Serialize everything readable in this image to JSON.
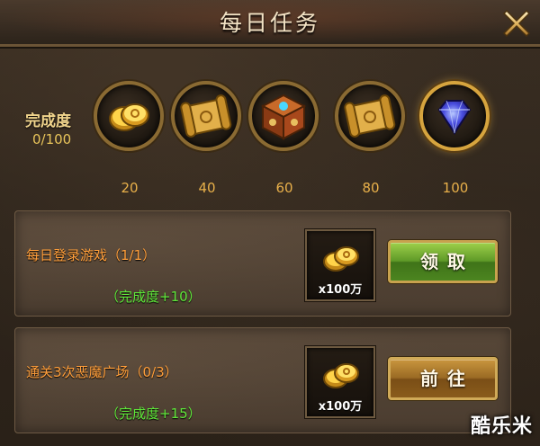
{
  "window": {
    "title": "每日任务",
    "close_icon": "close-x-icon"
  },
  "progress": {
    "label": "完成度",
    "value": "0/100",
    "current": 0,
    "max": 100
  },
  "rewards": [
    {
      "threshold": "20",
      "icon": "gold-coins-icon"
    },
    {
      "threshold": "40",
      "icon": "golden-scroll-icon"
    },
    {
      "threshold": "60",
      "icon": "treasure-box-icon"
    },
    {
      "threshold": "80",
      "icon": "golden-scroll-icon"
    },
    {
      "threshold": "100",
      "icon": "blue-diamond-icon"
    }
  ],
  "tasks": [
    {
      "name": "每日登录游戏（1/1）",
      "points": "（完成度+10）",
      "reward_qty": "x100万",
      "reward_icon": "gold-coins-icon",
      "button": "领取",
      "button_style": "green"
    },
    {
      "name": "通关3次恶魔广场（0/3）",
      "points": "（完成度+15）",
      "reward_qty": "x100万",
      "reward_icon": "gold-coins-icon",
      "button": "前往",
      "button_style": "brown"
    }
  ],
  "watermark": "酷乐米",
  "colors": {
    "task_name": "#ff9e3a",
    "task_points": "#5fe83a",
    "threshold": "#e8b04a",
    "title_text": "#f2e2c4"
  }
}
